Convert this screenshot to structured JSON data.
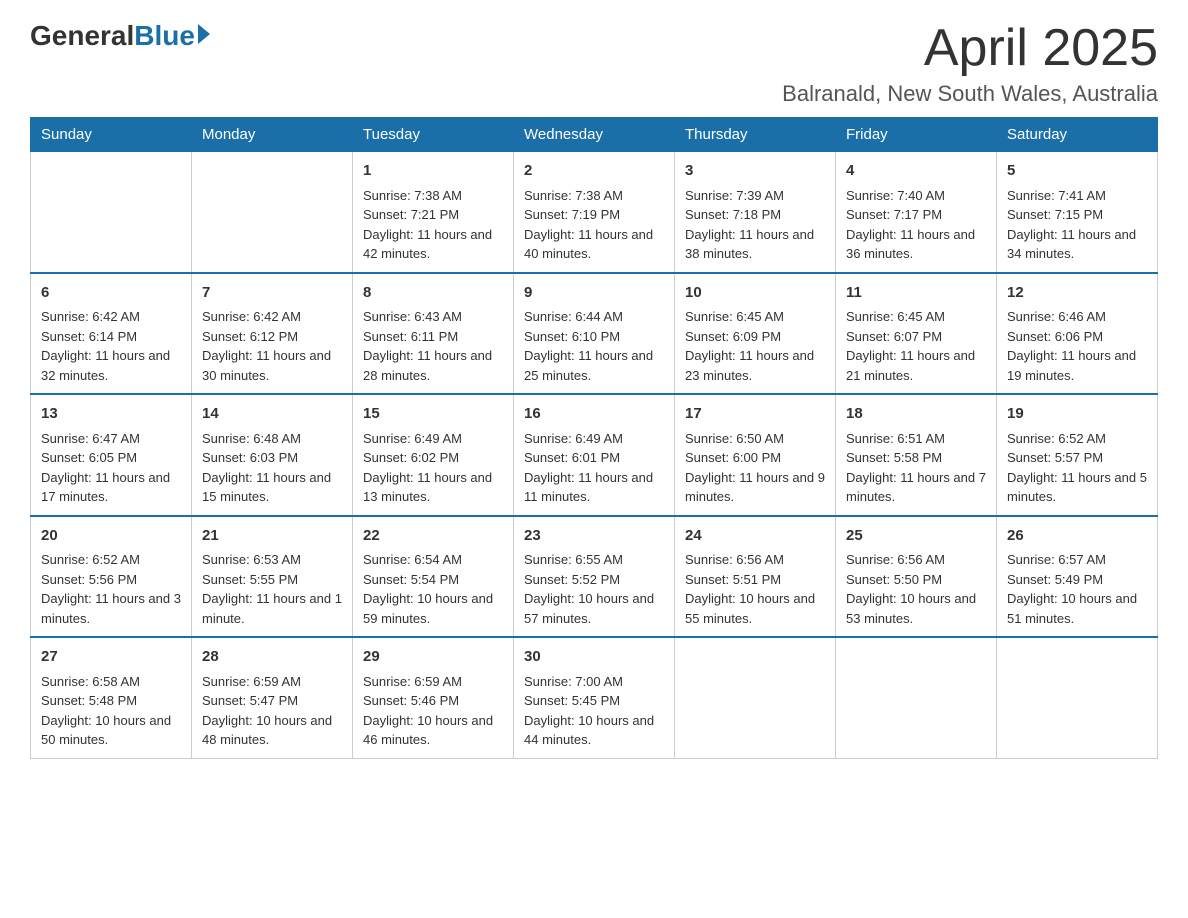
{
  "header": {
    "logo_general": "General",
    "logo_blue": "Blue",
    "month_title": "April 2025",
    "location": "Balranald, New South Wales, Australia"
  },
  "weekdays": [
    "Sunday",
    "Monday",
    "Tuesday",
    "Wednesday",
    "Thursday",
    "Friday",
    "Saturday"
  ],
  "weeks": [
    [
      {
        "day": "",
        "sunrise": "",
        "sunset": "",
        "daylight": ""
      },
      {
        "day": "",
        "sunrise": "",
        "sunset": "",
        "daylight": ""
      },
      {
        "day": "1",
        "sunrise": "Sunrise: 7:38 AM",
        "sunset": "Sunset: 7:21 PM",
        "daylight": "Daylight: 11 hours and 42 minutes."
      },
      {
        "day": "2",
        "sunrise": "Sunrise: 7:38 AM",
        "sunset": "Sunset: 7:19 PM",
        "daylight": "Daylight: 11 hours and 40 minutes."
      },
      {
        "day": "3",
        "sunrise": "Sunrise: 7:39 AM",
        "sunset": "Sunset: 7:18 PM",
        "daylight": "Daylight: 11 hours and 38 minutes."
      },
      {
        "day": "4",
        "sunrise": "Sunrise: 7:40 AM",
        "sunset": "Sunset: 7:17 PM",
        "daylight": "Daylight: 11 hours and 36 minutes."
      },
      {
        "day": "5",
        "sunrise": "Sunrise: 7:41 AM",
        "sunset": "Sunset: 7:15 PM",
        "daylight": "Daylight: 11 hours and 34 minutes."
      }
    ],
    [
      {
        "day": "6",
        "sunrise": "Sunrise: 6:42 AM",
        "sunset": "Sunset: 6:14 PM",
        "daylight": "Daylight: 11 hours and 32 minutes."
      },
      {
        "day": "7",
        "sunrise": "Sunrise: 6:42 AM",
        "sunset": "Sunset: 6:12 PM",
        "daylight": "Daylight: 11 hours and 30 minutes."
      },
      {
        "day": "8",
        "sunrise": "Sunrise: 6:43 AM",
        "sunset": "Sunset: 6:11 PM",
        "daylight": "Daylight: 11 hours and 28 minutes."
      },
      {
        "day": "9",
        "sunrise": "Sunrise: 6:44 AM",
        "sunset": "Sunset: 6:10 PM",
        "daylight": "Daylight: 11 hours and 25 minutes."
      },
      {
        "day": "10",
        "sunrise": "Sunrise: 6:45 AM",
        "sunset": "Sunset: 6:09 PM",
        "daylight": "Daylight: 11 hours and 23 minutes."
      },
      {
        "day": "11",
        "sunrise": "Sunrise: 6:45 AM",
        "sunset": "Sunset: 6:07 PM",
        "daylight": "Daylight: 11 hours and 21 minutes."
      },
      {
        "day": "12",
        "sunrise": "Sunrise: 6:46 AM",
        "sunset": "Sunset: 6:06 PM",
        "daylight": "Daylight: 11 hours and 19 minutes."
      }
    ],
    [
      {
        "day": "13",
        "sunrise": "Sunrise: 6:47 AM",
        "sunset": "Sunset: 6:05 PM",
        "daylight": "Daylight: 11 hours and 17 minutes."
      },
      {
        "day": "14",
        "sunrise": "Sunrise: 6:48 AM",
        "sunset": "Sunset: 6:03 PM",
        "daylight": "Daylight: 11 hours and 15 minutes."
      },
      {
        "day": "15",
        "sunrise": "Sunrise: 6:49 AM",
        "sunset": "Sunset: 6:02 PM",
        "daylight": "Daylight: 11 hours and 13 minutes."
      },
      {
        "day": "16",
        "sunrise": "Sunrise: 6:49 AM",
        "sunset": "Sunset: 6:01 PM",
        "daylight": "Daylight: 11 hours and 11 minutes."
      },
      {
        "day": "17",
        "sunrise": "Sunrise: 6:50 AM",
        "sunset": "Sunset: 6:00 PM",
        "daylight": "Daylight: 11 hours and 9 minutes."
      },
      {
        "day": "18",
        "sunrise": "Sunrise: 6:51 AM",
        "sunset": "Sunset: 5:58 PM",
        "daylight": "Daylight: 11 hours and 7 minutes."
      },
      {
        "day": "19",
        "sunrise": "Sunrise: 6:52 AM",
        "sunset": "Sunset: 5:57 PM",
        "daylight": "Daylight: 11 hours and 5 minutes."
      }
    ],
    [
      {
        "day": "20",
        "sunrise": "Sunrise: 6:52 AM",
        "sunset": "Sunset: 5:56 PM",
        "daylight": "Daylight: 11 hours and 3 minutes."
      },
      {
        "day": "21",
        "sunrise": "Sunrise: 6:53 AM",
        "sunset": "Sunset: 5:55 PM",
        "daylight": "Daylight: 11 hours and 1 minute."
      },
      {
        "day": "22",
        "sunrise": "Sunrise: 6:54 AM",
        "sunset": "Sunset: 5:54 PM",
        "daylight": "Daylight: 10 hours and 59 minutes."
      },
      {
        "day": "23",
        "sunrise": "Sunrise: 6:55 AM",
        "sunset": "Sunset: 5:52 PM",
        "daylight": "Daylight: 10 hours and 57 minutes."
      },
      {
        "day": "24",
        "sunrise": "Sunrise: 6:56 AM",
        "sunset": "Sunset: 5:51 PM",
        "daylight": "Daylight: 10 hours and 55 minutes."
      },
      {
        "day": "25",
        "sunrise": "Sunrise: 6:56 AM",
        "sunset": "Sunset: 5:50 PM",
        "daylight": "Daylight: 10 hours and 53 minutes."
      },
      {
        "day": "26",
        "sunrise": "Sunrise: 6:57 AM",
        "sunset": "Sunset: 5:49 PM",
        "daylight": "Daylight: 10 hours and 51 minutes."
      }
    ],
    [
      {
        "day": "27",
        "sunrise": "Sunrise: 6:58 AM",
        "sunset": "Sunset: 5:48 PM",
        "daylight": "Daylight: 10 hours and 50 minutes."
      },
      {
        "day": "28",
        "sunrise": "Sunrise: 6:59 AM",
        "sunset": "Sunset: 5:47 PM",
        "daylight": "Daylight: 10 hours and 48 minutes."
      },
      {
        "day": "29",
        "sunrise": "Sunrise: 6:59 AM",
        "sunset": "Sunset: 5:46 PM",
        "daylight": "Daylight: 10 hours and 46 minutes."
      },
      {
        "day": "30",
        "sunrise": "Sunrise: 7:00 AM",
        "sunset": "Sunset: 5:45 PM",
        "daylight": "Daylight: 10 hours and 44 minutes."
      },
      {
        "day": "",
        "sunrise": "",
        "sunset": "",
        "daylight": ""
      },
      {
        "day": "",
        "sunrise": "",
        "sunset": "",
        "daylight": ""
      },
      {
        "day": "",
        "sunrise": "",
        "sunset": "",
        "daylight": ""
      }
    ]
  ]
}
